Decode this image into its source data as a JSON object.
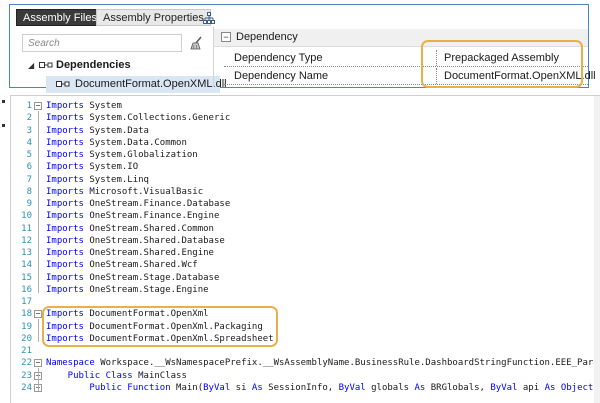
{
  "tabs": [
    {
      "label": "Assembly Files",
      "active": true
    },
    {
      "label": "Assembly Properties",
      "active": false
    }
  ],
  "toolbar": {
    "icon": "sitemap-icon"
  },
  "search": {
    "placeholder": "Search",
    "clear_icon": "broom-icon"
  },
  "tree": {
    "root_label": "Dependencies",
    "child_label": "DocumentFormat.OpenXML.dll"
  },
  "properties": {
    "category": "Dependency",
    "rows": [
      {
        "key": "Dependency Type",
        "value": "Prepackaged Assembly"
      },
      {
        "key": "Dependency Name",
        "value": "DocumentFormat.OpenXML.dll"
      }
    ]
  },
  "colors": {
    "accent_border": "#4a86c5",
    "highlight": "#e8b04a",
    "keyword": "#0000ff",
    "line_number": "#2b91af"
  },
  "code": {
    "lines": [
      {
        "n": "1",
        "kw": "Imports",
        "rest": " System",
        "fold": "minus"
      },
      {
        "n": "2",
        "kw": "Imports",
        "rest": " System.Collections.Generic"
      },
      {
        "n": "3",
        "kw": "Imports",
        "rest": " System.Data"
      },
      {
        "n": "4",
        "kw": "Imports",
        "rest": " System.Data.Common"
      },
      {
        "n": "5",
        "kw": "Imports",
        "rest": " System.Globalization"
      },
      {
        "n": "6",
        "kw": "Imports",
        "rest": " System.IO"
      },
      {
        "n": "7",
        "kw": "Imports",
        "rest": " System.Linq"
      },
      {
        "n": "8",
        "kw": "Imports",
        "rest": " Microsoft.VisualBasic"
      },
      {
        "n": "9",
        "kw": "Imports",
        "rest": " OneStream.Finance.Database"
      },
      {
        "n": "10",
        "kw": "Imports",
        "rest": " OneStream.Finance.Engine"
      },
      {
        "n": "11",
        "kw": "Imports",
        "rest": " OneStream.Shared.Common"
      },
      {
        "n": "12",
        "kw": "Imports",
        "rest": " OneStream.Shared.Database"
      },
      {
        "n": "13",
        "kw": "Imports",
        "rest": " OneStream.Shared.Engine"
      },
      {
        "n": "14",
        "kw": "Imports",
        "rest": " OneStream.Shared.Wcf"
      },
      {
        "n": "15",
        "kw": "Imports",
        "rest": " OneStream.Stage.Database"
      },
      {
        "n": "16",
        "kw": "Imports",
        "rest": " OneStream.Stage.Engine"
      },
      {
        "n": "17",
        "kw": "",
        "rest": ""
      },
      {
        "n": "18",
        "kw": "Imports",
        "rest": " DocumentFormat.OpenXml",
        "fold": "minus"
      },
      {
        "n": "19",
        "kw": "Imports",
        "rest": " DocumentFormat.OpenXml.Packaging"
      },
      {
        "n": "20",
        "kw": "Imports",
        "rest": " DocumentFormat.OpenXml.Spreadsheet"
      },
      {
        "n": "21",
        "kw": "",
        "rest": ""
      },
      {
        "n": "22",
        "kw": "Namespace",
        "rest": " Workspace.__WsNamespacePrefix.__WsAssemblyName.BusinessRule.DashboardStringFunction.EEE_ParamHelper",
        "fold": "minus"
      },
      {
        "n": "23",
        "kw": "    Public Class",
        "rest": " MainClass",
        "fold": "minus"
      },
      {
        "n": "24",
        "kw": "        Public Function",
        "rest": " Main(",
        "tail": [
          {
            "k": "ByVal",
            "t": " si "
          },
          {
            "k": "As",
            "t": " SessionInfo, "
          },
          {
            "k": "ByVal",
            "t": " globals "
          },
          {
            "k": "As",
            "t": " BRGlobals, "
          },
          {
            "k": "ByVal",
            "t": " api "
          },
          {
            "k": "As Object",
            "t": ", "
          },
          {
            "k": "ByVal",
            "t": " a"
          }
        ],
        "fold": "minus"
      }
    ]
  }
}
